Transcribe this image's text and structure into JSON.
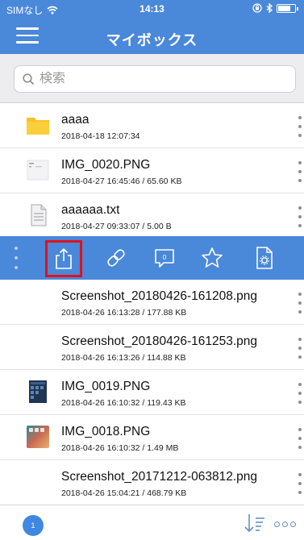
{
  "status_bar": {
    "carrier": "SIMなし",
    "time": "14:13"
  },
  "nav": {
    "title": "マイボックス"
  },
  "search": {
    "placeholder": "検索"
  },
  "files": [
    {
      "name": "aaaa",
      "meta": "2018-04-18 12:07:34",
      "icon": "folder-icon"
    },
    {
      "name": "IMG_0020.PNG",
      "meta": "2018-04-27 16:45:46 / 65.60 KB",
      "icon": "image-thumbnail"
    },
    {
      "name": "aaaaaa.txt",
      "meta": "2018-04-27 09:33:07 / 5.00 B",
      "icon": "text-file-icon"
    },
    {
      "name": "Screenshot_20180426-161208.png",
      "meta": "2018-04-26 16:13:28 / 177.88 KB",
      "icon": "none"
    },
    {
      "name": "Screenshot_20180426-161253.png",
      "meta": "2018-04-26 16:13:26 / 114.88 KB",
      "icon": "none"
    },
    {
      "name": "IMG_0019.PNG",
      "meta": "2018-04-26 16:10:32 / 119.43 KB",
      "icon": "image-thumbnail"
    },
    {
      "name": "IMG_0018.PNG",
      "meta": "2018-04-26 16:10:32 / 1.49 MB",
      "icon": "image-thumbnail"
    },
    {
      "name": "Screenshot_20171212-063812.png",
      "meta": "2018-04-26 15:04:21 / 468.79 KB",
      "icon": "none"
    }
  ],
  "action_bar": {
    "comment_count": "0",
    "actions": [
      "share-icon",
      "link-icon",
      "comment-icon",
      "star-icon",
      "file-settings-icon"
    ],
    "highlighted": "share-icon"
  },
  "footer": {
    "page": "1"
  },
  "colors": {
    "header_blue": "#4a88d9",
    "highlight_red": "#e3101a",
    "folder_yellow": "#f7c22b"
  }
}
